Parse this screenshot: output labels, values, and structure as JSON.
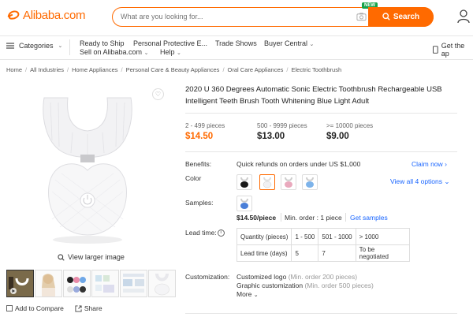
{
  "header": {
    "logo_text": "Alibaba.com",
    "search_placeholder": "What are you looking for...",
    "search_button": "Search",
    "new_badge": "NEW",
    "app_label": "Ap"
  },
  "nav": {
    "categories": "Categories",
    "items": [
      "Ready to Ship",
      "Personal Protective E...",
      "Trade Shows",
      "Buyer Central",
      "Sell on Alibaba.com",
      "Help"
    ],
    "get_app": "Get the ap"
  },
  "breadcrumbs": [
    "Home",
    "All Industries",
    "Home Appliances",
    "Personal Care & Beauty Appliances",
    "Oral Care Appliances",
    "Electric Toothbrush"
  ],
  "product": {
    "title": "2020 U 360 Degrees Automatic Sonic Electric Toothbrush Rechargeable USB Intelligent Teeth Brush Tooth Whitening Blue Light Adult",
    "view_larger": "View larger image",
    "add_to_compare": "Add to Compare",
    "share": "Share",
    "tiers": [
      {
        "qty": "2 - 499 pieces",
        "price": "$14.50"
      },
      {
        "qty": "500 - 9999 pieces",
        "price": "$13.00"
      },
      {
        "qty": ">= 10000 pieces",
        "price": "$9.00"
      }
    ],
    "benefits_label": "Benefits:",
    "benefits_text": "Quick refunds on orders under US $1,000",
    "claim_now": "Claim now",
    "color_label": "Color",
    "view_all_options": "View all 4 options",
    "samples_label": "Samples:",
    "sample_price": "$14.50/piece",
    "min_order": "Min. order : 1 piece",
    "get_samples": "Get samples",
    "lead_time_label": "Lead time:",
    "lead_table": {
      "row1": [
        "Quantity (pieces)",
        "1 - 500",
        "501 - 1000",
        "> 1000"
      ],
      "row2": [
        "Lead time (days)",
        "5",
        "7",
        "To be negotiated"
      ]
    },
    "customization_label": "Customization:",
    "custom_logo": "Customized logo",
    "custom_logo_min": "(Min. order 200 pieces)",
    "graphic_custom": "Graphic customization",
    "graphic_custom_min": "(Min. order 500 pieces)",
    "more": "More"
  },
  "colors": {
    "brand": "#ff6a00",
    "link": "#1a66ff",
    "new_badge": "#16a34a"
  }
}
